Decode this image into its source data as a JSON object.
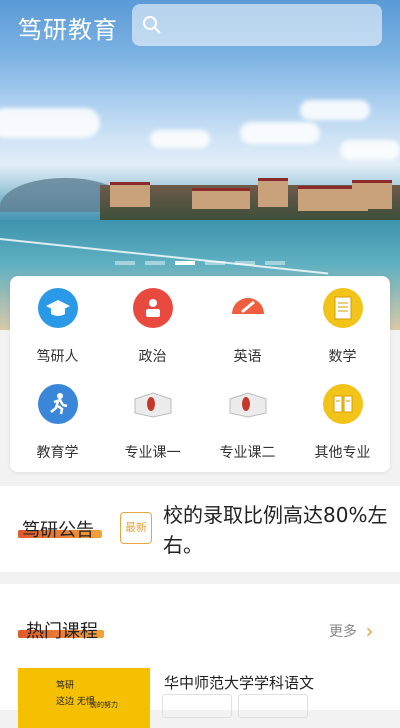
{
  "header": {
    "title": "笃研教育",
    "search_icon": "search-icon"
  },
  "banner": {
    "dot_count": 6,
    "active_index": 2
  },
  "categories": [
    {
      "label": "笃研人",
      "icon": "graduation-cap-icon",
      "color": "#2a9ae8"
    },
    {
      "label": "政治",
      "icon": "reader-icon",
      "color": "#e84a3f"
    },
    {
      "label": "英语",
      "icon": "pencil-icon",
      "color": "#ef5e3d"
    },
    {
      "label": "数学",
      "icon": "document-icon",
      "color": "#f2c318"
    },
    {
      "label": "教育学",
      "icon": "runner-icon",
      "color": "#3a86d8"
    },
    {
      "label": "专业课一",
      "icon": "open-book-icon",
      "color": "#c33a2a"
    },
    {
      "label": "专业课二",
      "icon": "open-book-icon",
      "color": "#c33a2a"
    },
    {
      "label": "其他专业",
      "icon": "book-icon",
      "color": "#f2c318"
    }
  ],
  "notice": {
    "title": "笃研公告",
    "badge": "最新",
    "text": "校的录取比例高达80%左右。"
  },
  "hot_courses": {
    "title": "热门课程",
    "more": "更多",
    "items": [
      {
        "title": "华中师范大学学科语文",
        "thumb_lines": [
          "笃研",
          "这边 无惧",
          "前的努力"
        ]
      }
    ]
  },
  "colors": {
    "accent": "#e0582b",
    "accent2": "#f3a33a",
    "badge": "#e6a443"
  }
}
